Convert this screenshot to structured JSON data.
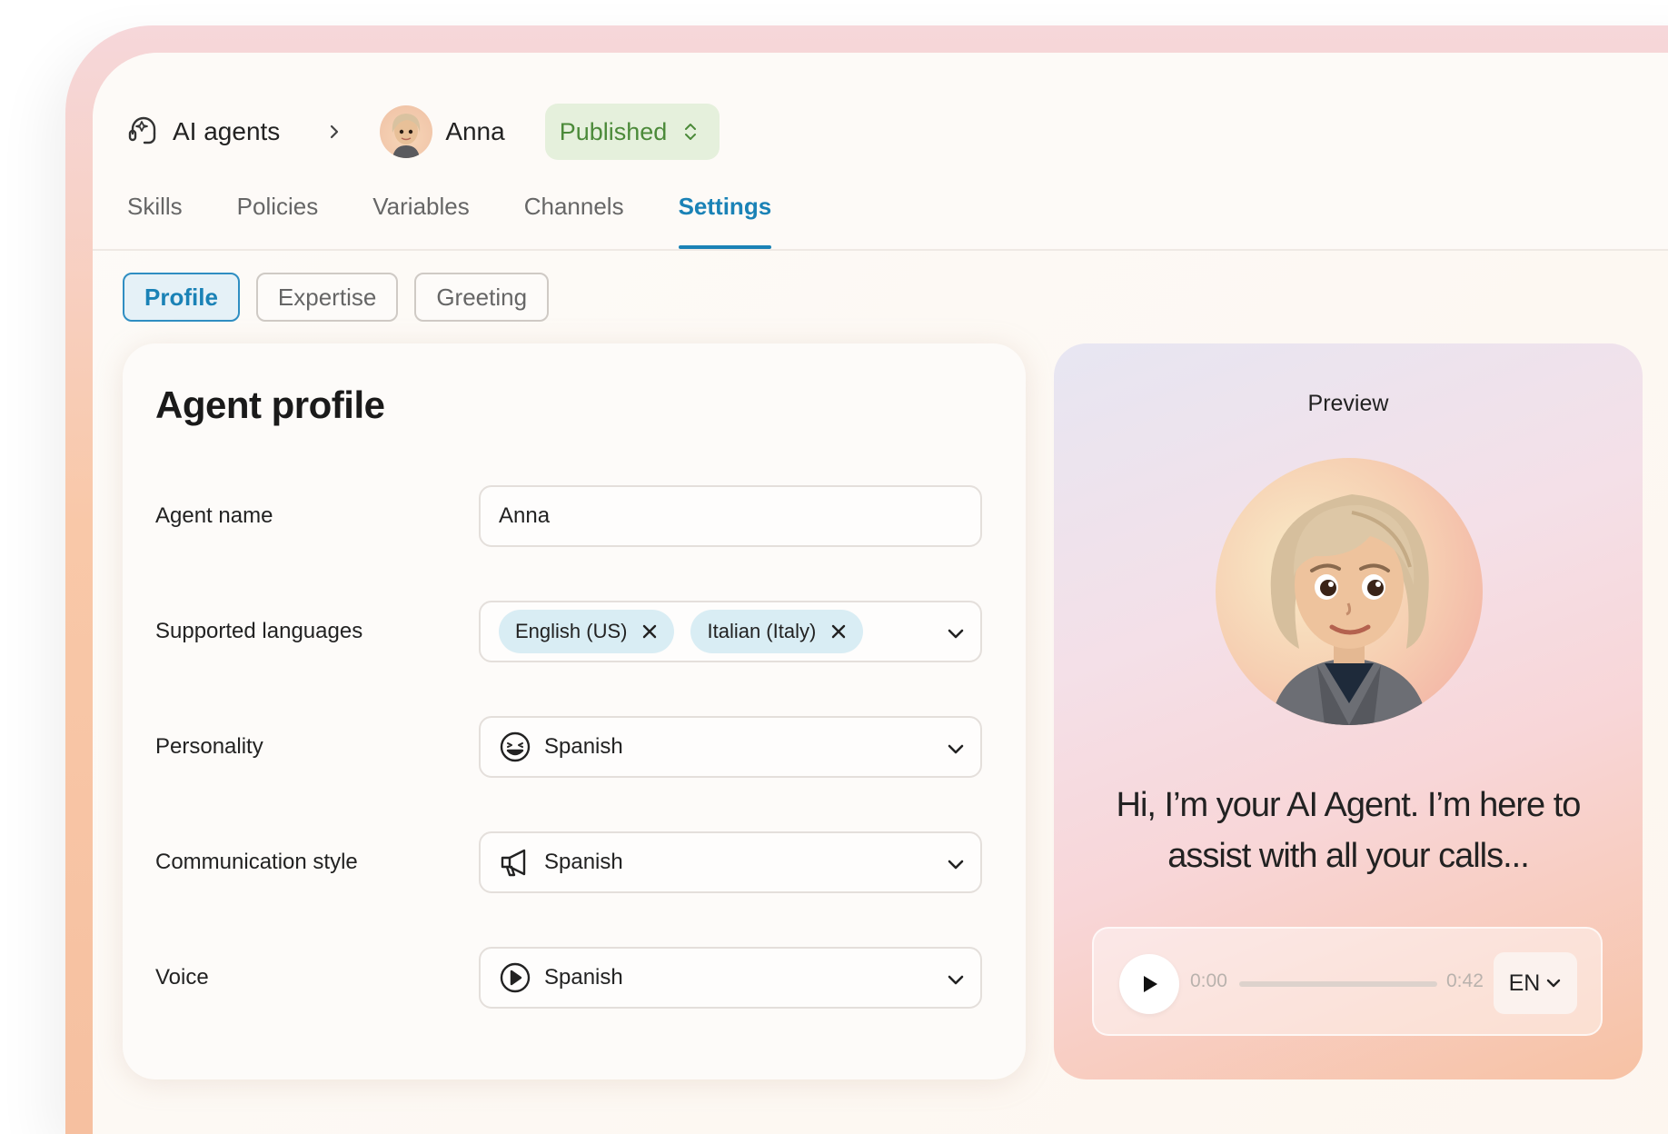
{
  "breadcrumb": {
    "root_label": "AI agents",
    "agent_name": "Anna",
    "status": "Published"
  },
  "tabs": [
    {
      "label": "Skills",
      "active": false
    },
    {
      "label": "Policies",
      "active": false
    },
    {
      "label": "Variables",
      "active": false
    },
    {
      "label": "Channels",
      "active": false
    },
    {
      "label": "Settings",
      "active": true
    }
  ],
  "subtabs": [
    {
      "label": "Profile",
      "active": true
    },
    {
      "label": "Expertise",
      "active": false
    },
    {
      "label": "Greeting",
      "active": false
    }
  ],
  "profile": {
    "title": "Agent profile",
    "agent_name_label": "Agent name",
    "agent_name_value": "Anna",
    "languages_label": "Supported languages",
    "languages": [
      "English (US)",
      "Italian (Italy)"
    ],
    "personality_label": "Personality",
    "personality_value": "Spanish",
    "personality_icon": "smile-icon",
    "communication_label": "Communication style",
    "communication_value": "Spanish",
    "communication_icon": "megaphone-icon",
    "voice_label": "Voice",
    "voice_value": "Spanish",
    "voice_icon": "play-circle-icon"
  },
  "preview": {
    "title": "Preview",
    "message": "Hi, I’m your AI Agent. I’m here to assist with all your calls...",
    "player": {
      "current_time": "0:00",
      "duration": "0:42",
      "progress": 0,
      "language": "EN"
    }
  },
  "colors": {
    "accent": "#1a82b6",
    "published_bg": "#e5f0dc",
    "published_text": "#4b8a39",
    "chip_bg": "#d9edf4"
  }
}
